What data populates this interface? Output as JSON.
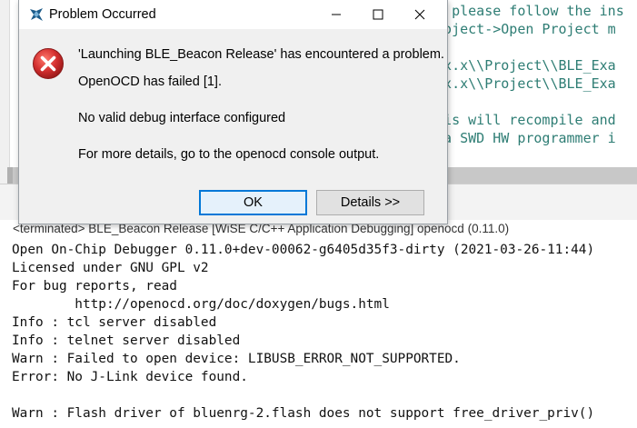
{
  "dialog": {
    "title": "Problem Occurred",
    "message": "'Launching BLE_Beacon Release' has encountered a problem.",
    "error_line": "OpenOCD has failed [1].",
    "detail_line": "No valid debug interface configured",
    "hint_line": "For more details, go to the openocd console output.",
    "ok_label": "OK",
    "details_label": "Details >>"
  },
  "editor": {
    "lines": [
      "M, please follow the ins",
      "Project->Open Project m",
      "x.x.x\\\\Project\\\\BLE_Exa",
      "x.x.x\\\\Project\\\\BLE_Exa",
      "This will recompile and",
      "t a SWD HW programmer i"
    ]
  },
  "console": {
    "header": "<terminated> BLE_Beacon Release [WiSE C/C++ Application Debugging] openocd (0.11.0)",
    "lines": [
      "Open On-Chip Debugger 0.11.0+dev-00062-g6405d35f3-dirty (2021-03-26-11:44)",
      "Licensed under GNU GPL v2",
      "For bug reports, read",
      "        http://openocd.org/doc/doxygen/bugs.html",
      "Info : tcl server disabled",
      "Info : telnet server disabled",
      "Warn : Failed to open device: LIBUSB_ERROR_NOT_SUPPORTED.",
      "Error: No J-Link device found.",
      "",
      "Warn : Flash driver of bluenrg-2.flash does not support free_driver_priv()"
    ]
  },
  "colors": {
    "accent": "#0078d7",
    "error": "#d32f2f",
    "editor_text": "#2e7d74"
  }
}
